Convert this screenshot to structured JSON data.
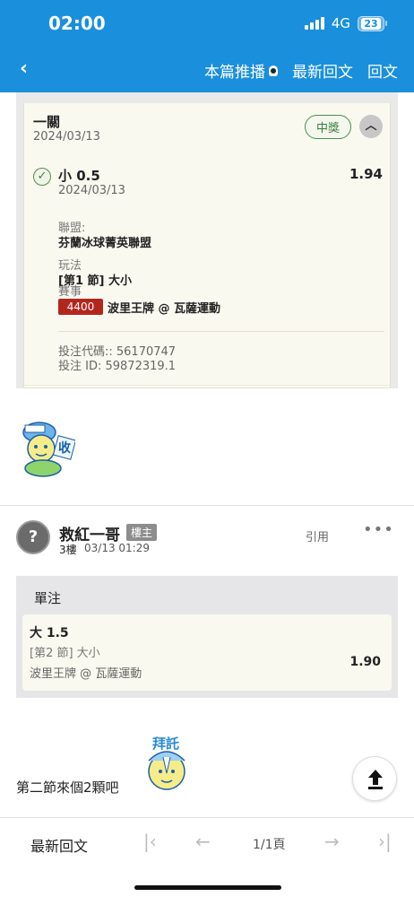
{
  "status_bar": {
    "time": "02:00",
    "network": "4G",
    "battery": "23"
  },
  "nav": {
    "back": "‹",
    "recommend": "本篇推播",
    "latest_reply": "最新回文",
    "reply": "回文"
  },
  "bet_card": {
    "title": "一關",
    "date": "2024/03/13",
    "status_badge": "中獎",
    "pick": "小 0.5",
    "odds": "1.94",
    "pick_date": "2024/03/13",
    "league_label": "聯盟:",
    "league": "芬蘭冰球菁英聯盟",
    "play_label": "玩法",
    "play": "[第1 節] 大小",
    "event_label": "賽事",
    "event_id": "4400",
    "event": "波里王牌 @ 瓦薩運動",
    "bet_code": "投注代碼:: 56170747",
    "bet_id": "投注 ID: 59872319.1"
  },
  "sticker1": {
    "text": "收"
  },
  "post": {
    "username": "救紅一哥",
    "owner_badge": "樓主",
    "floor": "3樓",
    "time": "03/13 01:29",
    "quote": "引用",
    "more": "•••",
    "single": {
      "title": "單注",
      "pick": "大 1.5",
      "period": "[第2 節] 大小",
      "event": "波里王牌 @ 瓦薩運動",
      "odds": "1.90"
    },
    "sticker_text": "拜託",
    "comment": "第二節來個2顆吧"
  },
  "bottom_bar": {
    "latest": "最新回文",
    "first": "|‹",
    "prev": "←",
    "page": "1/1頁",
    "next": "→",
    "last": "›|"
  },
  "colors": {
    "header_blue": "#1a8fdc",
    "win_green": "#4a8f52",
    "event_red": "#b3261e"
  }
}
